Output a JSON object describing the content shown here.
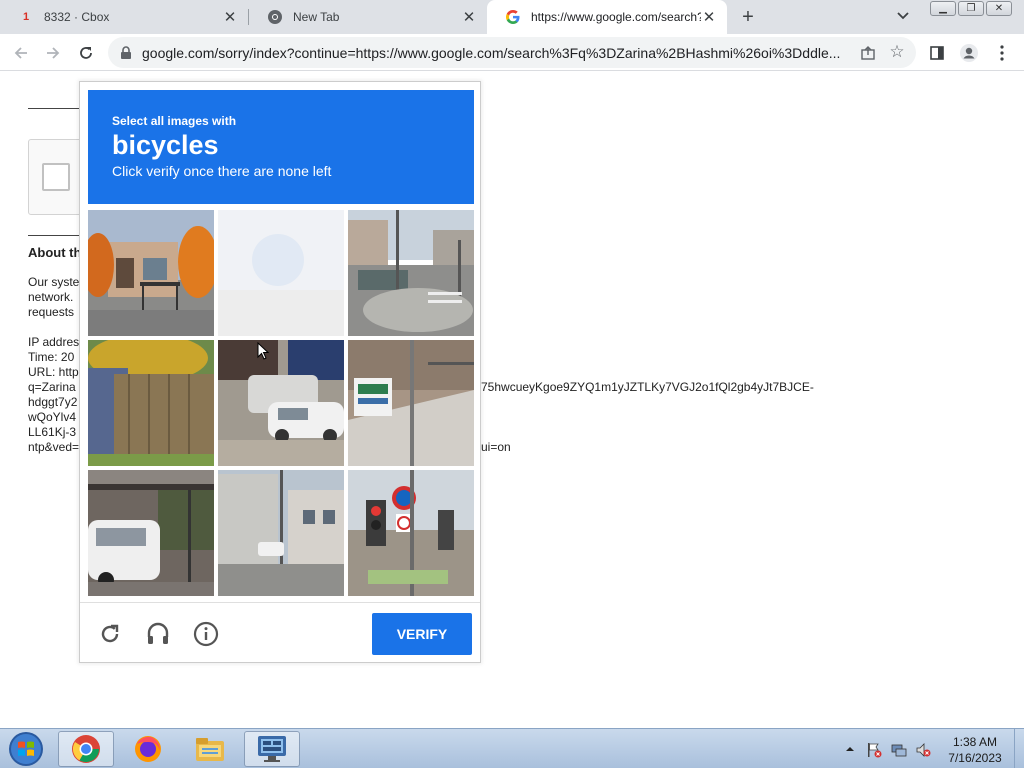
{
  "browser": {
    "tabs": [
      {
        "title": "8332 · Cbox",
        "favicon": "cbox-icon",
        "badge": "1"
      },
      {
        "title": "New Tab",
        "favicon": "chrome-icon"
      },
      {
        "title": "https://www.google.com/search?",
        "favicon": "google-icon",
        "active": true
      }
    ],
    "url": "google.com/sorry/index?continue=https://www.google.com/search%3Fq%3DZarina%2BHashmi%26oi%3Dddle..."
  },
  "page": {
    "about_heading": "About th",
    "text_lines": [
      "Our syste",
      "network.",
      "requests"
    ],
    "ip_label": "IP addres",
    "time_label": "Time: 20",
    "url_label": "URL: http",
    "url_lines": [
      "q=Zarina",
      "hdggt7y2",
      "wQoYlv4",
      "LL61Kj-3",
      "ntp&ved="
    ],
    "url_right_1": "75hwcueyKgoe9ZYQ1m1yJZTLKy7VGJ2o1fQl2gb4yJt7BJCE-",
    "url_right_2": "ui=on"
  },
  "captcha": {
    "instruction_small": "Select all images with",
    "target": "bicycles",
    "instruction_sub": "Click verify once there are none left",
    "verify_label": "VERIFY",
    "tiles": [
      "storefront-autumn-trees-bus-shelter",
      "faded-blank-tile",
      "street-corner-with-poles",
      "wooden-fence-with-tree",
      "parked-white-cars",
      "wall-with-signboard",
      "covered-parking-white-car",
      "narrow-residential-street",
      "traffic-light-and-signs"
    ],
    "colors": {
      "header": "#1a73e8",
      "button": "#1a73e8"
    }
  },
  "taskbar": {
    "apps": [
      "chrome-icon",
      "firefox-icon",
      "explorer-icon",
      "network-monitor-icon"
    ],
    "time": "1:38 AM",
    "date": "7/16/2023"
  }
}
